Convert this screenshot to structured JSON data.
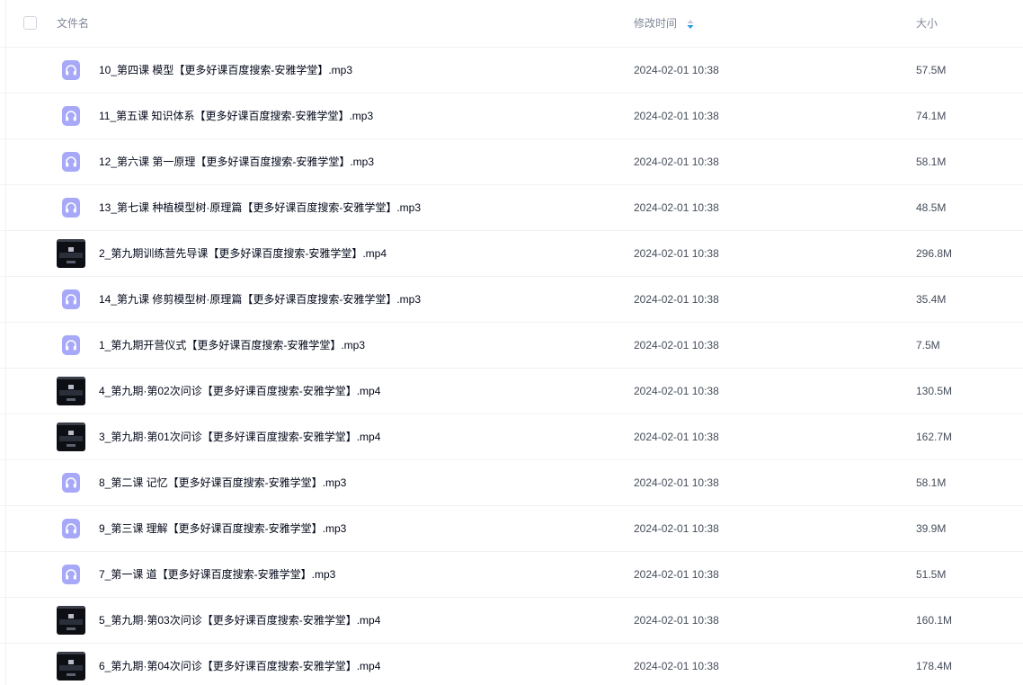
{
  "header": {
    "name_label": "文件名",
    "time_label": "修改时间",
    "size_label": "大小"
  },
  "colors": {
    "audio_icon": "#a7a9f8",
    "video_thumb": "#0d0f14",
    "sort_active": "#1f9be8"
  },
  "files": [
    {
      "name": "10_第四课 模型【更多好课百度搜索-安雅学堂】.mp3",
      "time": "2024-02-01 10:38",
      "size": "57.5M",
      "icon": "audio-file-icon"
    },
    {
      "name": "11_第五课 知识体系【更多好课百度搜索-安雅学堂】.mp3",
      "time": "2024-02-01 10:38",
      "size": "74.1M",
      "icon": "audio-file-icon"
    },
    {
      "name": "12_第六课 第一原理【更多好课百度搜索-安雅学堂】.mp3",
      "time": "2024-02-01 10:38",
      "size": "58.1M",
      "icon": "audio-file-icon"
    },
    {
      "name": "13_第七课 种植模型树·原理篇【更多好课百度搜索-安雅学堂】.mp3",
      "time": "2024-02-01 10:38",
      "size": "48.5M",
      "icon": "audio-file-icon"
    },
    {
      "name": "2_第九期训练营先导课【更多好课百度搜索-安雅学堂】.mp4",
      "time": "2024-02-01 10:38",
      "size": "296.8M",
      "icon": "video-thumbnail"
    },
    {
      "name": "14_第九课 修剪模型树·原理篇【更多好课百度搜索-安雅学堂】.mp3",
      "time": "2024-02-01 10:38",
      "size": "35.4M",
      "icon": "audio-file-icon"
    },
    {
      "name": "1_第九期开营仪式【更多好课百度搜索-安雅学堂】.mp3",
      "time": "2024-02-01 10:38",
      "size": "7.5M",
      "icon": "audio-file-icon"
    },
    {
      "name": "4_第九期·第02次问诊【更多好课百度搜索-安雅学堂】.mp4",
      "time": "2024-02-01 10:38",
      "size": "130.5M",
      "icon": "video-thumbnail"
    },
    {
      "name": "3_第九期·第01次问诊【更多好课百度搜索-安雅学堂】.mp4",
      "time": "2024-02-01 10:38",
      "size": "162.7M",
      "icon": "video-thumbnail"
    },
    {
      "name": "8_第二课 记忆【更多好课百度搜索-安雅学堂】.mp3",
      "time": "2024-02-01 10:38",
      "size": "58.1M",
      "icon": "audio-file-icon"
    },
    {
      "name": "9_第三课 理解【更多好课百度搜索-安雅学堂】.mp3",
      "time": "2024-02-01 10:38",
      "size": "39.9M",
      "icon": "audio-file-icon"
    },
    {
      "name": "7_第一课 道【更多好课百度搜索-安雅学堂】.mp3",
      "time": "2024-02-01 10:38",
      "size": "51.5M",
      "icon": "audio-file-icon"
    },
    {
      "name": "5_第九期·第03次问诊【更多好课百度搜索-安雅学堂】.mp4",
      "time": "2024-02-01 10:38",
      "size": "160.1M",
      "icon": "video-thumbnail"
    },
    {
      "name": "6_第九期·第04次问诊【更多好课百度搜索-安雅学堂】.mp4",
      "time": "2024-02-01 10:38",
      "size": "178.4M",
      "icon": "video-thumbnail"
    }
  ]
}
